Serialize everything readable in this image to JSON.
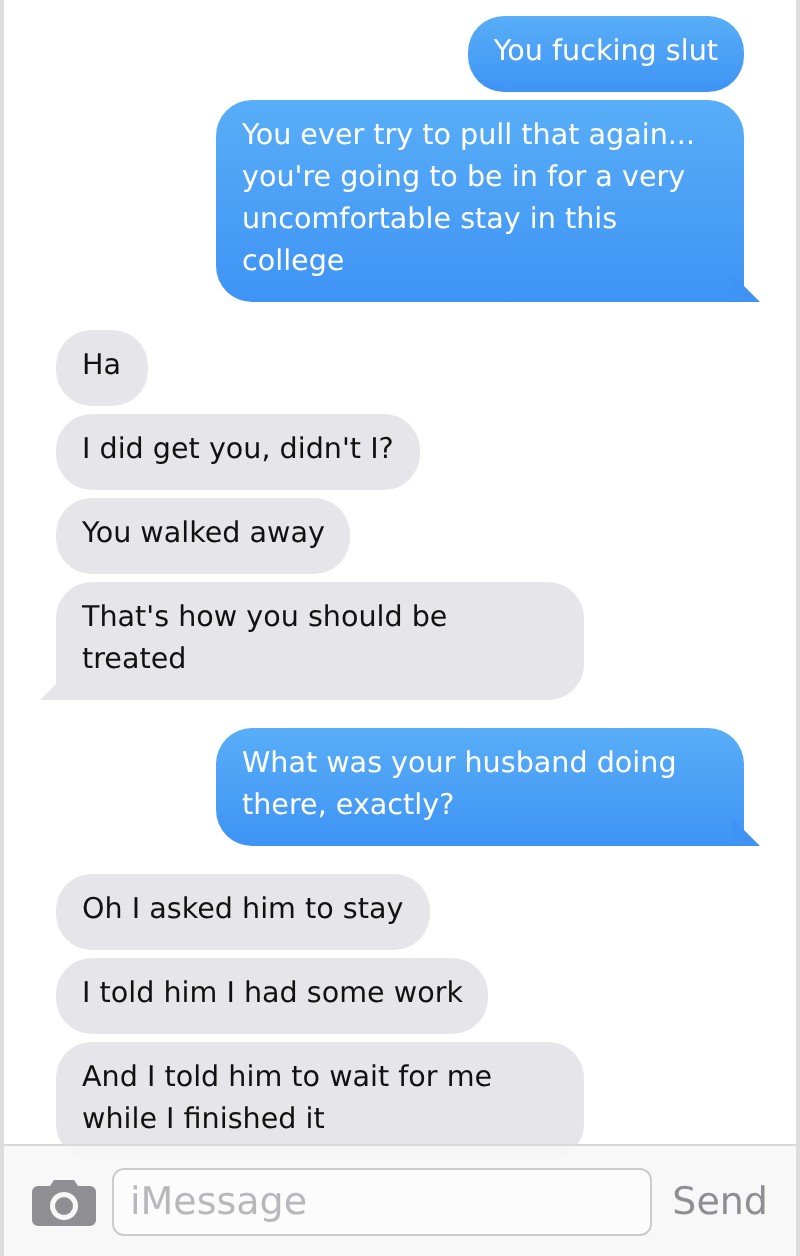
{
  "messages": [
    {
      "kind": "sent",
      "text": "You fucking slut"
    },
    {
      "kind": "sent",
      "text": "You ever try to pull that again... you're going to be in for a very uncomfortable stay in this college"
    },
    {
      "kind": "received",
      "text": "Ha"
    },
    {
      "kind": "received",
      "text": "I did get you, didn't I?"
    },
    {
      "kind": "received",
      "text": "You walked away"
    },
    {
      "kind": "received",
      "text": "That's how you should be treated"
    },
    {
      "kind": "sent",
      "text": "What was your husband doing there, exactly?"
    },
    {
      "kind": "received",
      "text": "Oh I asked him to stay"
    },
    {
      "kind": "received",
      "text": "I told him I had some work"
    },
    {
      "kind": "received",
      "text": "And I told him to wait for me while I finished it"
    }
  ],
  "composer": {
    "placeholder": "iMessage",
    "send": "Send"
  }
}
